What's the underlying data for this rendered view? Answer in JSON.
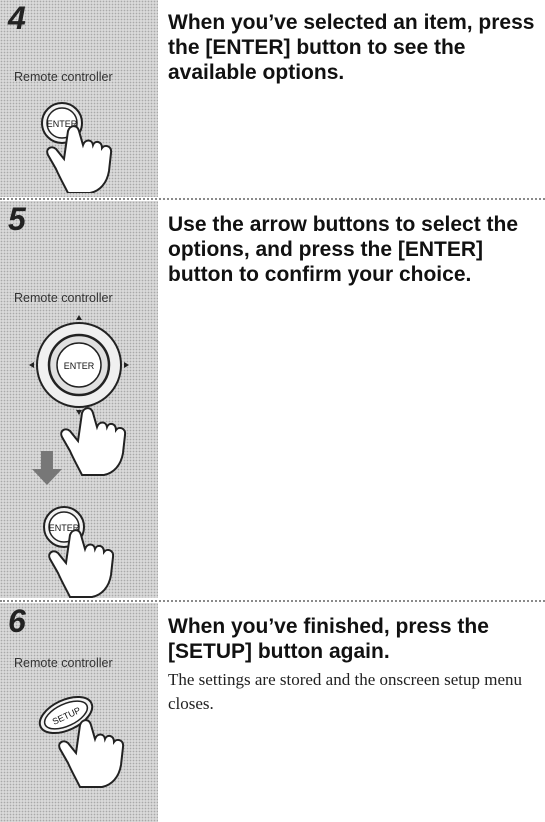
{
  "steps": [
    {
      "number": "4",
      "side_label": "Remote controller",
      "instruction": "When you’ve selected an item, press the [ENTER] button to see the available options.",
      "button_labels": [
        "ENTER"
      ]
    },
    {
      "number": "5",
      "side_label": "Remote controller",
      "instruction": "Use the arrow buttons to select the options, and press the [ENTER] button to confirm your choice.",
      "button_labels": [
        "ENTER",
        "ENTER"
      ]
    },
    {
      "number": "6",
      "side_label": "Remote controller",
      "instruction": "When you’ve finished, press the [SETUP] button again.",
      "note": "The settings are stored and the onscreen setup menu closes.",
      "button_labels": [
        "SETUP"
      ]
    }
  ]
}
